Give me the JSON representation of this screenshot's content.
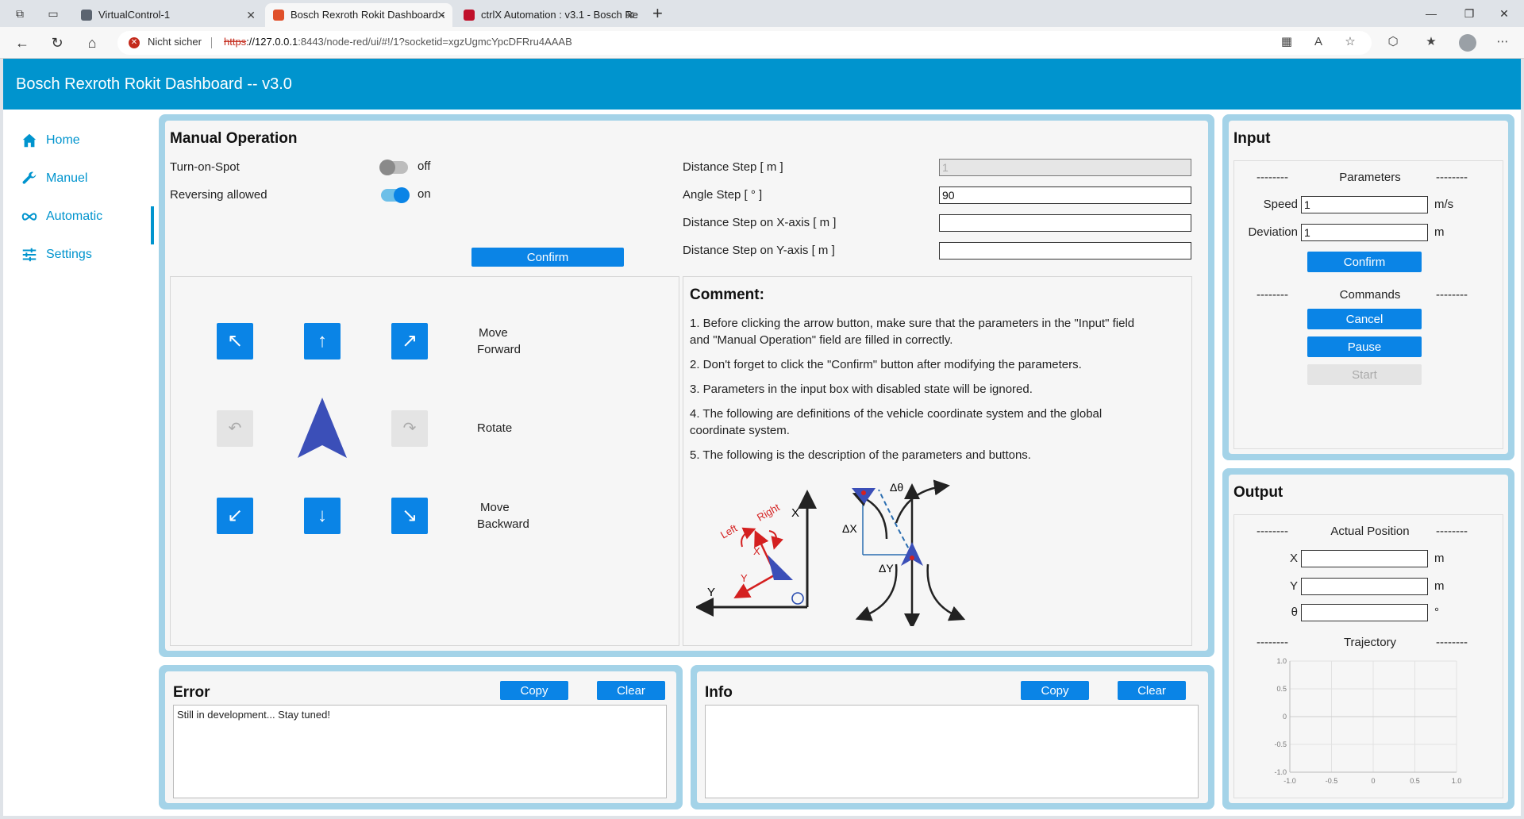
{
  "browser": {
    "tabs": [
      {
        "title": "VirtualControl-1",
        "favicon_color": "#5b6470"
      },
      {
        "title": "Bosch Rexroth Rokit Dashboard -",
        "favicon_color": "#e0502a"
      },
      {
        "title": "ctrlX Automation : v3.1 - Bosch Re",
        "favicon_color": "#c0102a"
      }
    ],
    "security_label": "Nicht sicher",
    "url_proto": "https",
    "url_host": "://127.0.0.1",
    "url_rest": ":8443/node-red/ui/#!/1?socketid=xgzUgmcYpcDFRru4AAAB"
  },
  "app": {
    "title": "Bosch Rexroth Rokit Dashboard -- v3.0",
    "accent": "#0094ce",
    "button_color": "#0a84e6",
    "nav": [
      {
        "label": "Home",
        "icon": "home-icon"
      },
      {
        "label": "Manuel",
        "icon": "wrench-icon"
      },
      {
        "label": "Automatic",
        "icon": "infinity-icon"
      },
      {
        "label": "Settings",
        "icon": "sliders-icon"
      }
    ]
  },
  "manual": {
    "title": "Manual Operation",
    "turn_on_spot_label": "Turn-on-Spot",
    "turn_on_spot_state": "off",
    "reversing_label": "Reversing allowed",
    "reversing_state": "on",
    "confirm_label": "Confirm",
    "distance_step_label": "Distance Step [ m ]",
    "distance_step_value": "1",
    "angle_step_label": "Angle Step [ ° ]",
    "angle_step_value": "90",
    "x_step_label": "Distance Step on X-axis [ m ]",
    "x_step_value": "",
    "y_step_label": "Distance Step on Y-axis [ m ]",
    "y_step_value": "",
    "move_forward_1": "Move",
    "move_forward_2": "Forward",
    "rotate_label": "Rotate",
    "move_backward_1": "Move",
    "move_backward_2": "Backward"
  },
  "comment": {
    "title": "Comment:",
    "lines": [
      "1. Before clicking the arrow button, make sure that the parameters in the \"Input\" field",
      "and \"Manual Operation\" field are filled in correctly.",
      "2. Don't forget to click the \"Confirm\" button after modifying the parameters.",
      "3. Parameters in the input box with disabled state will be ignored.",
      "4. The following are definitions of the vehicle coordinate system and the global",
      "coordinate system.",
      "5. The following is the description of the parameters and buttons."
    ],
    "diagram": {
      "left_label": "Left",
      "right_label": "Right",
      "x_label": "X",
      "y_label": "Y",
      "dtheta_label": "Δθ",
      "dx_label": "ΔX",
      "dy_label": "ΔY"
    }
  },
  "input": {
    "title": "Input",
    "dashes": "--------",
    "parameters_header": "Parameters",
    "speed_label": "Speed",
    "speed_value": "1",
    "speed_unit": "m/s",
    "deviation_label": "Deviation",
    "deviation_value": "1",
    "deviation_unit": "m",
    "confirm_label": "Confirm",
    "commands_header": "Commands",
    "cancel_label": "Cancel",
    "pause_label": "Pause",
    "start_label": "Start"
  },
  "output": {
    "title": "Output",
    "position_header": "Actual Position",
    "x_label": "X",
    "x_unit": "m",
    "y_label": "Y",
    "y_unit": "m",
    "theta_label": "θ",
    "theta_unit": "°",
    "trajectory_header": "Trajectory"
  },
  "chart_data": {
    "type": "line",
    "title": "Trajectory",
    "series": [],
    "xlim": [
      -1.0,
      1.0
    ],
    "ylim": [
      -1.0,
      1.0
    ],
    "xticks": [
      "-1.0",
      "-0.5",
      "0",
      "0.5",
      "1.0"
    ],
    "yticks": [
      "1.0",
      "0.5",
      "0",
      "-0.5",
      "-1.0"
    ],
    "grid": true
  },
  "error": {
    "title": "Error",
    "copy_label": "Copy",
    "clear_label": "Clear",
    "text": "Still in development... Stay tuned!"
  },
  "info": {
    "title": "Info",
    "copy_label": "Copy",
    "clear_label": "Clear",
    "text": ""
  }
}
